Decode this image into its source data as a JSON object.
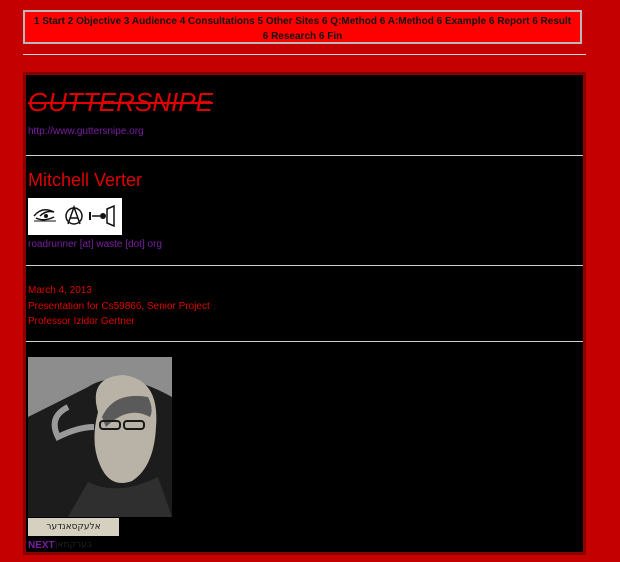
{
  "nav": {
    "items": [
      "1 Start",
      "2 Objective",
      "3 Audience",
      "4 Consultations",
      "5 Other Sites",
      "6 Q:Method",
      "6 A:Method",
      "6 Example",
      "6 Report",
      "6 Result",
      "6 Research",
      "6 Fin"
    ]
  },
  "header": {
    "title": "GUTTERSNIPE",
    "url": "http://www.guttersnipe.org"
  },
  "author": {
    "name": "Mitchell Verter",
    "email": "roadrunner [at] waste [dot] org"
  },
  "info": {
    "date": "March 4, 2013",
    "presentation": "Presentation for Cs59866, Senior Project",
    "professor": "Professor Izidor Gertner"
  },
  "photo": {
    "caption": "אלעקסאנדער בערקמאן"
  },
  "next_label": "NEXT",
  "colors": {
    "page_bg": "#c40000",
    "nav_bg": "#ff0000",
    "content_bg": "#000000",
    "heading": "#e00000",
    "link": "#7a1ea0"
  }
}
